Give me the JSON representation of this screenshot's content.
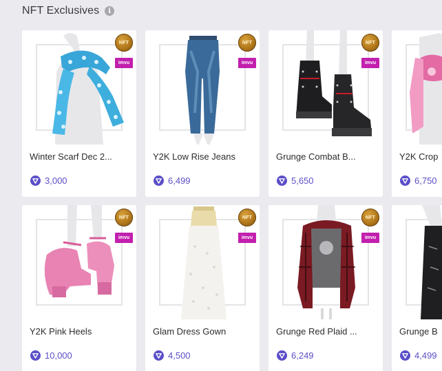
{
  "section": {
    "title": "NFT Exclusives",
    "info_icon": "i"
  },
  "badges": {
    "nft": "NFT",
    "brand": "imvu"
  },
  "colors": {
    "price": "#5b4fc8",
    "nft_gold": "#b0761a",
    "imvu_magenta": "#c21fae",
    "background": "#ebeaef"
  },
  "items": [
    {
      "name": "Winter Scarf Dec 2...",
      "price": "3,000",
      "icon": "scarf"
    },
    {
      "name": "Y2K Low Rise Jeans",
      "price": "6,499",
      "icon": "jeans"
    },
    {
      "name": "Grunge Combat B...",
      "price": "5,650",
      "icon": "boots"
    },
    {
      "name": "Y2K Crop",
      "price": "6,750",
      "icon": "crop-top"
    },
    {
      "name": "Y2K Pink Heels",
      "price": "10,000",
      "icon": "heels"
    },
    {
      "name": "Glam Dress Gown",
      "price": "4,500",
      "icon": "gown"
    },
    {
      "name": "Grunge Red Plaid ...",
      "price": "6,249",
      "icon": "plaid-shirt"
    },
    {
      "name": "Grunge B",
      "price": "4,499",
      "icon": "pants"
    }
  ]
}
